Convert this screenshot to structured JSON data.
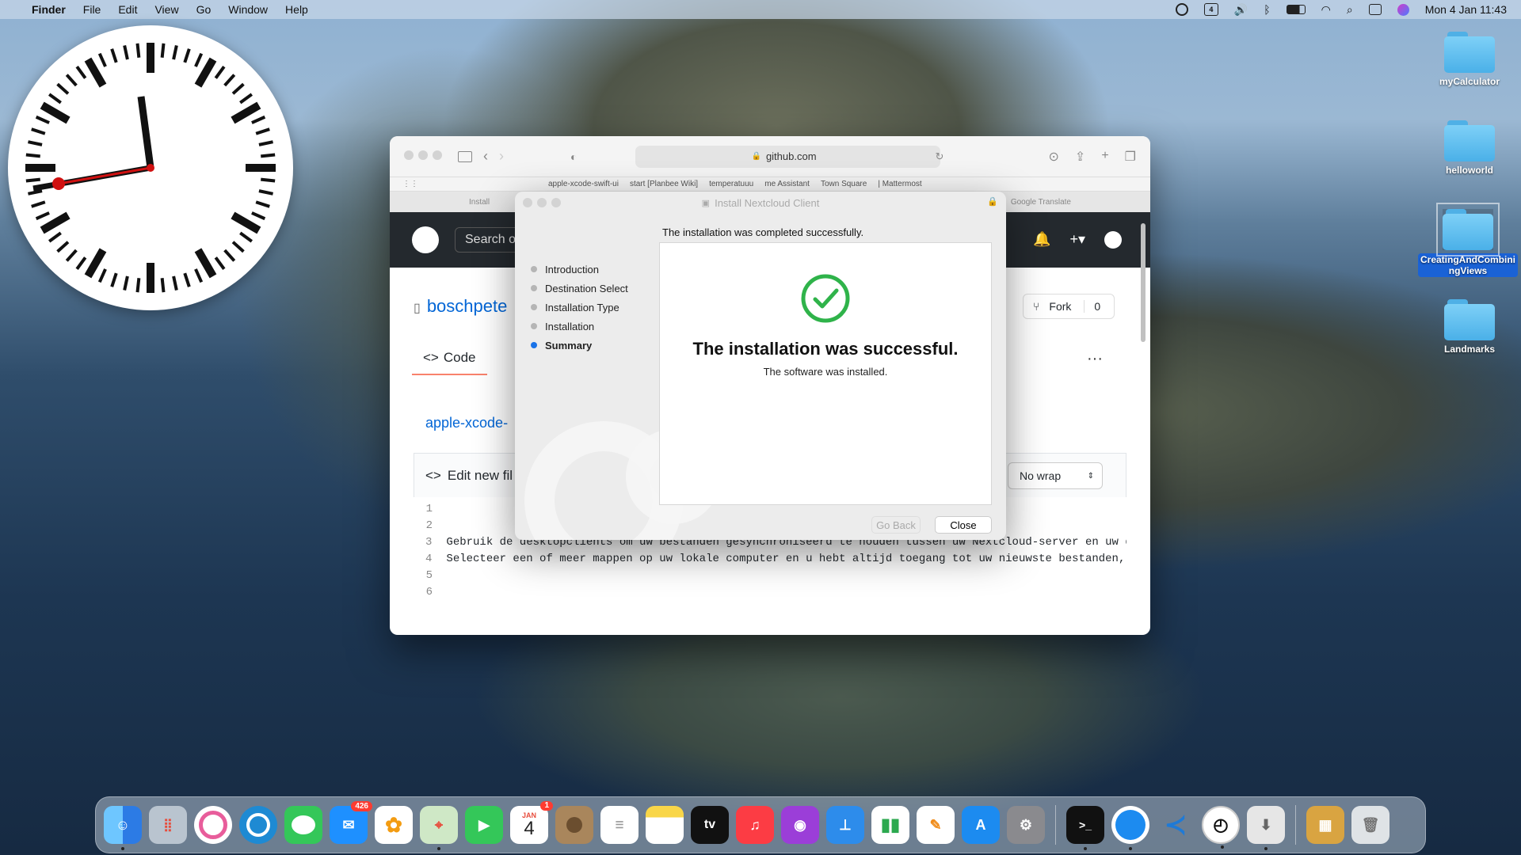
{
  "menubar": {
    "app_name": "Finder",
    "menus": [
      "File",
      "Edit",
      "View",
      "Go",
      "Window",
      "Help"
    ],
    "datetime": "Mon 4 Jan  11:43",
    "calendar_day": "4"
  },
  "desktop_icons": [
    {
      "label": "myCalculator",
      "selected": false
    },
    {
      "label": "helloworld",
      "selected": false
    },
    {
      "label": "CreatingAndCombiningViews",
      "selected": true
    },
    {
      "label": "Landmarks",
      "selected": false
    }
  ],
  "safari": {
    "url": "github.com",
    "favorites": [
      "apple-xcode-swift-ui",
      "start [Planbee Wiki]",
      "temperatuuu",
      "me Assistant",
      "Town Square",
      "| Mattermost"
    ],
    "tabs": [
      "Install",
      "Google Translate"
    ],
    "github": {
      "search_placeholder": "Search o",
      "repo_owner": "boschpete",
      "code_tab": "Code",
      "branch": "apple-xcode-",
      "edit_label": "Edit new fil",
      "wrap_mode": "No wrap",
      "fork_label": "Fork",
      "fork_count": "0",
      "code_lines": [
        {
          "n": "1",
          "text": ""
        },
        {
          "n": "2",
          "text": ""
        },
        {
          "n": "3",
          "text": "Gebruik de desktopclients om uw bestanden gesynchroniseerd te houden tussen uw Nextcloud-server en uw de"
        },
        {
          "n": "4",
          "text": "Selecteer een of meer mappen op uw lokale computer en u hebt altijd toegang tot uw nieuwste bestanden, w"
        },
        {
          "n": "5",
          "text": ""
        },
        {
          "n": "6",
          "text": ""
        }
      ]
    }
  },
  "installer": {
    "title": "Install Nextcloud Client",
    "heading": "The installation was completed successfully.",
    "steps": [
      {
        "label": "Introduction",
        "current": false
      },
      {
        "label": "Destination Select",
        "current": false
      },
      {
        "label": "Installation Type",
        "current": false
      },
      {
        "label": "Installation",
        "current": false
      },
      {
        "label": "Summary",
        "current": true
      }
    ],
    "success_title": "The installation was successful.",
    "success_sub": "The software was installed.",
    "go_back": "Go Back",
    "close": "Close"
  },
  "dock": {
    "mail_badge": "426",
    "calendar_month": "JAN",
    "calendar_day": "4",
    "calendar_badge": "1",
    "tv_label": "tv",
    "colors": {
      "accent": "#1a73e8",
      "success": "#2fb34a",
      "badge": "#ff3b30"
    }
  }
}
